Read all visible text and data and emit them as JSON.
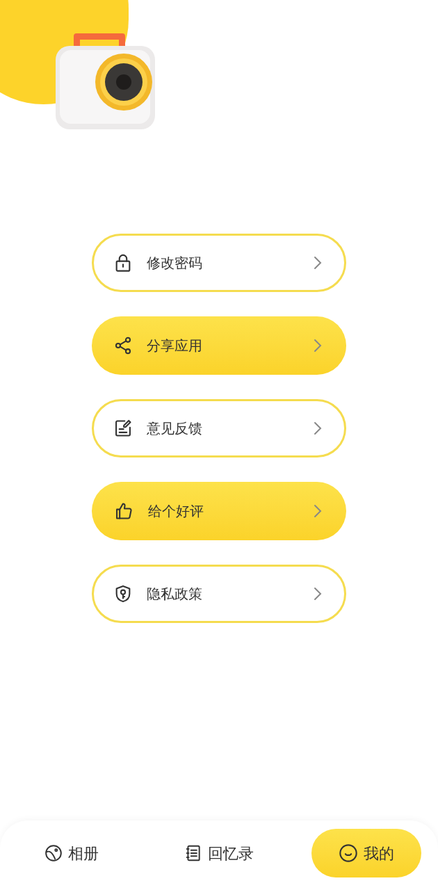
{
  "menu": [
    {
      "label": "修改密码",
      "filled": false
    },
    {
      "label": "分享应用",
      "filled": true
    },
    {
      "label": "意见反馈",
      "filled": false
    },
    {
      "label": "给个好评",
      "filled": true
    },
    {
      "label": "隐私政策",
      "filled": false
    }
  ],
  "tabs": [
    {
      "label": "相册",
      "selected": false
    },
    {
      "label": "回忆录",
      "selected": false
    },
    {
      "label": "我的",
      "selected": true
    }
  ]
}
